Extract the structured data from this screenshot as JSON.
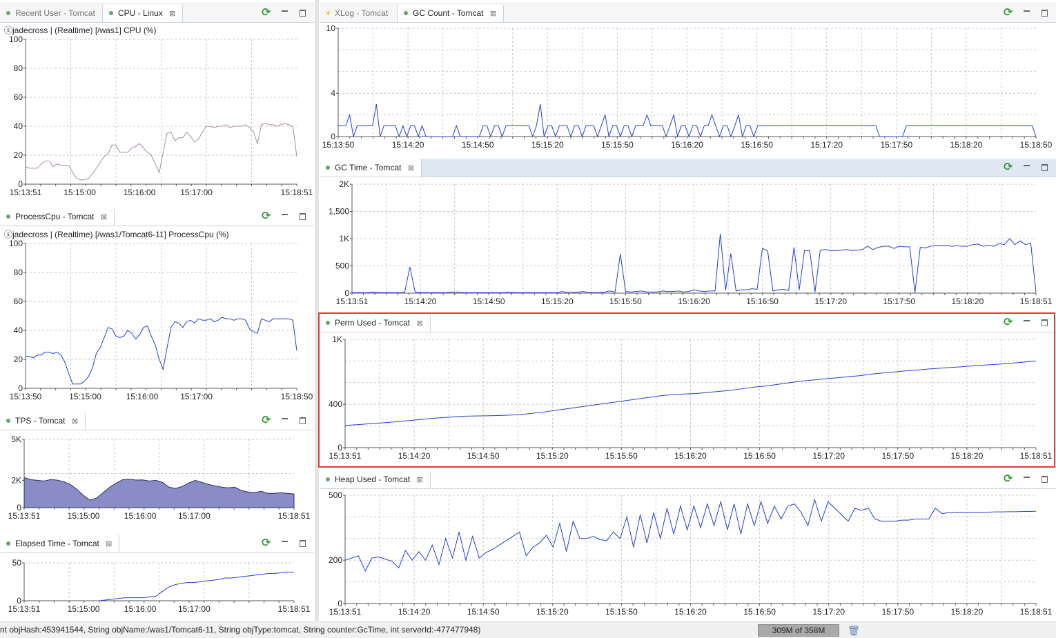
{
  "colors": {
    "cpu_line": "#a889a5",
    "blue_line": "#1f3fd6",
    "area_fill": "#8a8cc6",
    "highlight": "#e53935"
  },
  "panels": {
    "cpu": {
      "tabs": [
        {
          "label": "Recent User - Tomcat",
          "active": false,
          "close": false
        },
        {
          "label": "CPU - Linux",
          "active": true,
          "close": true
        }
      ],
      "subtitle": "ⓢjadecross | (Realtime) [/was1] CPU (%)",
      "chart_data": {
        "type": "line",
        "ylim": [
          0,
          100
        ],
        "yticks": [
          "100",
          "80",
          "60",
          "40",
          "20",
          "0"
        ],
        "xticks": [
          "15:13:51",
          "15:15:00",
          "15:16:00",
          "15:17:00",
          "15:18:51"
        ],
        "series": [
          {
            "values": [
              12,
              11,
              11,
              11,
              14,
              16,
              16,
              12,
              14,
              13,
              13,
              13,
              8,
              4,
              3,
              3,
              4,
              7,
              11,
              15,
              19,
              21,
              27,
              27,
              22,
              22,
              22,
              25,
              26,
              28,
              25,
              22,
              20,
              14,
              8,
              22,
              35,
              36,
              30,
              32,
              32,
              36,
              33,
              29,
              31,
              36,
              40,
              40,
              39,
              40,
              40,
              41,
              39,
              40,
              40,
              40,
              41,
              39,
              36,
              28,
              41,
              42,
              41,
              41,
              40,
              41,
              42,
              41,
              40,
              19
            ]
          }
        ]
      }
    },
    "process_cpu": {
      "tabs": [
        {
          "label": "ProcessCpu - Tomcat",
          "active": true,
          "close": true
        }
      ],
      "subtitle": "ⓢjadecross | (Realtime) [/was1/Tomcat6-11] ProcessCpu (%)",
      "chart_data": {
        "type": "line",
        "ylim": [
          0,
          100
        ],
        "yticks": [
          "100",
          "80",
          "60",
          "40",
          "20",
          "0"
        ],
        "xticks": [
          "15:13:50",
          "15:15:00",
          "15:16:00",
          "15:17:00",
          "15:18:50"
        ],
        "series": [
          {
            "values": [
              22,
              22,
              21,
              23,
              23,
              25,
              25,
              24,
              25,
              23,
              18,
              10,
              3,
              3,
              3,
              5,
              8,
              14,
              24,
              28,
              35,
              42,
              41,
              36,
              35,
              36,
              40,
              38,
              34,
              37,
              42,
              43,
              36,
              30,
              20,
              13,
              28,
              42,
              46,
              45,
              42,
              46,
              47,
              45,
              48,
              47,
              47,
              48,
              46,
              47,
              49,
              48,
              48,
              47,
              48,
              48,
              47,
              41,
              39,
              38,
              48,
              47,
              46,
              48,
              48,
              48,
              48,
              48,
              47,
              26
            ]
          }
        ]
      }
    },
    "tps": {
      "tabs": [
        {
          "label": "TPS - Tomcat",
          "active": true,
          "close": true
        }
      ],
      "chart_data": {
        "type": "area",
        "ylim": [
          0,
          5000
        ],
        "yticks": [
          "5K",
          "2K",
          "0"
        ],
        "xticks": [
          "15:13:51",
          "15:15:00",
          "15:16:00",
          "15:17:00",
          "15:18:51"
        ],
        "series": [
          {
            "values": [
              2200,
              2050,
              2000,
              1950,
              2050,
              2020,
              1900,
              1700,
              1350,
              900,
              550,
              700,
              1100,
              1500,
              1800,
              2050,
              2080,
              2020,
              2030,
              1950,
              2000,
              1850,
              1500,
              1400,
              1550,
              1800,
              2000,
              1850,
              1700,
              1600,
              1500,
              1450,
              1500,
              1250,
              1150,
              1100,
              1200,
              1050,
              1050,
              1100,
              1050,
              1000
            ]
          }
        ]
      }
    },
    "elapsed": {
      "tabs": [
        {
          "label": "Elapsed Time - Tomcat",
          "active": true,
          "close": true
        }
      ],
      "chart_data": {
        "type": "line",
        "ylim": [
          0,
          50
        ],
        "yticks": [
          "50",
          "0"
        ],
        "xticks": [
          "15:13:51",
          "15:15:00",
          "15:16:00",
          "15:17:00",
          "15:18:51"
        ],
        "series": [
          {
            "values": [
              null,
              null,
              null,
              null,
              null,
              null,
              null,
              null,
              null,
              null,
              null,
              null,
              0,
              1,
              2,
              3,
              4,
              4,
              4,
              4,
              5,
              6,
              12,
              18,
              21,
              23,
              24,
              24,
              25,
              26,
              27,
              28,
              30,
              30,
              31,
              32,
              33,
              34,
              35,
              36,
              36,
              37,
              38,
              37
            ]
          }
        ]
      }
    },
    "gc_count": {
      "tabs": [
        {
          "label": "XLog - Tomcat",
          "active": false,
          "close": false,
          "star": true
        },
        {
          "label": "GC Count - Tomcat",
          "active": true,
          "close": true
        }
      ],
      "chart_data": {
        "type": "line",
        "ylim": [
          0,
          10
        ],
        "yticks": [
          "10",
          "4",
          "0"
        ],
        "xticks": [
          "15:13:50",
          "15:14:20",
          "15:14:50",
          "15:15:20",
          "15:15:50",
          "15:16:20",
          "15:16:50",
          "15:17:20",
          "15:17:50",
          "15:18:20",
          "15:18:50"
        ],
        "series": [
          {
            "values": [
              1,
              1,
              1,
              2,
              0,
              1,
              1,
              1,
              1,
              1,
              3,
              0,
              1,
              1,
              1,
              1,
              0,
              1,
              0,
              1,
              1,
              0,
              1,
              0,
              0,
              0,
              0,
              0,
              0,
              0,
              0,
              1,
              0,
              0,
              0,
              0,
              0,
              0,
              1,
              1,
              0,
              1,
              1,
              0,
              1,
              1,
              1,
              1,
              1,
              1,
              1,
              0,
              1,
              3,
              0,
              1,
              1,
              0,
              1,
              1,
              1,
              0,
              1,
              1,
              0,
              1,
              1,
              1,
              0,
              1,
              2,
              0,
              1,
              1,
              0,
              1,
              1,
              0,
              1,
              1,
              1,
              2,
              1,
              1,
              1,
              1,
              0,
              1,
              2,
              0,
              1,
              1,
              0,
              1,
              1,
              0,
              1,
              1,
              2,
              1,
              0,
              1,
              1,
              0,
              1,
              2,
              0,
              1,
              1,
              0,
              1,
              1,
              1,
              1,
              1,
              1,
              1,
              1,
              1,
              1,
              1,
              1,
              1,
              1,
              1,
              1,
              1,
              1,
              1,
              1,
              1,
              1,
              1,
              1,
              1,
              1,
              1,
              1,
              1,
              1,
              1,
              1,
              0,
              0,
              0,
              0,
              0,
              0,
              0,
              1,
              1,
              1,
              1,
              1,
              1,
              1,
              1,
              1,
              1,
              1,
              1,
              1,
              1,
              1,
              1,
              1,
              1,
              1,
              1,
              1,
              1,
              1,
              1,
              1,
              1,
              1,
              1,
              1,
              1,
              1,
              1,
              1,
              1,
              0
            ]
          }
        ]
      }
    },
    "gc_time": {
      "tabs": [
        {
          "label": "GC Time - Tomcat",
          "active": true,
          "close": true
        }
      ],
      "chart_data": {
        "type": "line",
        "ylim": [
          0,
          2000
        ],
        "yticks": [
          "2K",
          "1,500",
          "1K",
          "500",
          "0"
        ],
        "xticks": [
          "15:13:51",
          "15:14:20",
          "15:14:50",
          "15:15:20",
          "15:15:50",
          "15:16:20",
          "15:16:50",
          "15:17:20",
          "15:17:50",
          "15:18:20",
          "15:18:51"
        ],
        "series": [
          {
            "values": [
              10,
              10,
              10,
              10,
              20,
              10,
              10,
              10,
              10,
              10,
              10,
              480,
              20,
              10,
              10,
              10,
              10,
              10,
              10,
              20,
              20,
              10,
              10,
              10,
              10,
              10,
              10,
              10,
              10,
              10,
              20,
              10,
              10,
              10,
              10,
              10,
              10,
              10,
              10,
              10,
              30,
              10,
              10,
              20,
              30,
              10,
              10,
              10,
              20,
              40,
              20,
              720,
              30,
              20,
              30,
              40,
              20,
              20,
              20,
              40,
              30,
              30,
              40,
              20,
              30,
              60,
              40,
              30,
              40,
              40,
              1090,
              50,
              730,
              40,
              60,
              60,
              80,
              70,
              820,
              780,
              40,
              60,
              70,
              50,
              840,
              60,
              780,
              780,
              20,
              790,
              800,
              780,
              780,
              790,
              800,
              780,
              790,
              800,
              860,
              800,
              840,
              860,
              860,
              820,
              860,
              850,
              850,
              10,
              840,
              830,
              860,
              880,
              870,
              880,
              860,
              870,
              860,
              860,
              890,
              900,
              860,
              880,
              860,
              910,
              890,
              1000,
              890,
              960,
              890,
              920,
              10
            ]
          }
        ]
      }
    },
    "perm_used": {
      "tabs": [
        {
          "label": "Perm Used - Tomcat",
          "active": true,
          "close": true
        }
      ],
      "chart_data": {
        "type": "line",
        "ylim": [
          0,
          1000
        ],
        "yticks": [
          "1K",
          "400",
          "0"
        ],
        "xticks": [
          "15:13:51",
          "15:14:20",
          "15:14:50",
          "15:15:20",
          "15:15:50",
          "15:16:20",
          "15:16:50",
          "15:17:20",
          "15:17:50",
          "15:18:20",
          "15:18:51"
        ],
        "series": [
          {
            "values": [
              205,
              212,
              220,
              228,
              236,
              245,
              255,
              266,
              275,
              282,
              290,
              292,
              294,
              296,
              300,
              305,
              318,
              330,
              345,
              360,
              375,
              390,
              405,
              420,
              435,
              450,
              465,
              480,
              490,
              495,
              500,
              510,
              520,
              530,
              545,
              560,
              570,
              585,
              600,
              615,
              625,
              635,
              645,
              655,
              665,
              680,
              690,
              700,
              710,
              718,
              728,
              735,
              742,
              750,
              758,
              765,
              772,
              780,
              790,
              800
            ]
          }
        ]
      }
    },
    "heap_used": {
      "tabs": [
        {
          "label": "Heap Used - Tomcat",
          "active": true,
          "close": true
        }
      ],
      "chart_data": {
        "type": "line",
        "ylim": [
          0,
          500
        ],
        "yticks": [
          "500",
          "200",
          "0"
        ],
        "xticks": [
          "15:13:51",
          "15:14:20",
          "15:14:50",
          "15:15:20",
          "15:15:50",
          "15:16:20",
          "15:16:50",
          "15:17:20",
          "15:17:50",
          "15:18:20",
          "15:18:51"
        ],
        "series": [
          {
            "values": [
              200,
              210,
              220,
              150,
              210,
              215,
              205,
              195,
              165,
              245,
              200,
              240,
              200,
              270,
              180,
              300,
              210,
              330,
              200,
              310,
              210,
              235,
              250,
              270,
              290,
              310,
              330,
              220,
              260,
              280,
              315,
              260,
              370,
              240,
              380,
              300,
              300,
              310,
              295,
              290,
              330,
              300,
              400,
              260,
              410,
              280,
              420,
              300,
              440,
              320,
              450,
              340,
              450,
              350,
              460,
              360,
              470,
              340,
              460,
              320,
              460,
              360,
              470,
              370,
              450,
              390,
              450,
              460,
              420,
              360,
              480,
              380,
              470,
              440,
              410,
              380,
              440,
              430,
              440,
              390,
              380,
              380,
              380,
              385,
              385,
              390,
              390,
              390,
              440,
              415,
              420,
              420,
              420,
              420,
              420,
              420,
              422,
              423,
              423,
              424,
              424,
              425,
              425,
              426
            ]
          }
        ]
      }
    }
  },
  "status": {
    "message": "nt objHash:453941544, String objName:/was1/Tomcat6-11, String objType:tomcat, String counter:GcTime, int serverId:-477477948)",
    "heap": "309M of 358M"
  }
}
